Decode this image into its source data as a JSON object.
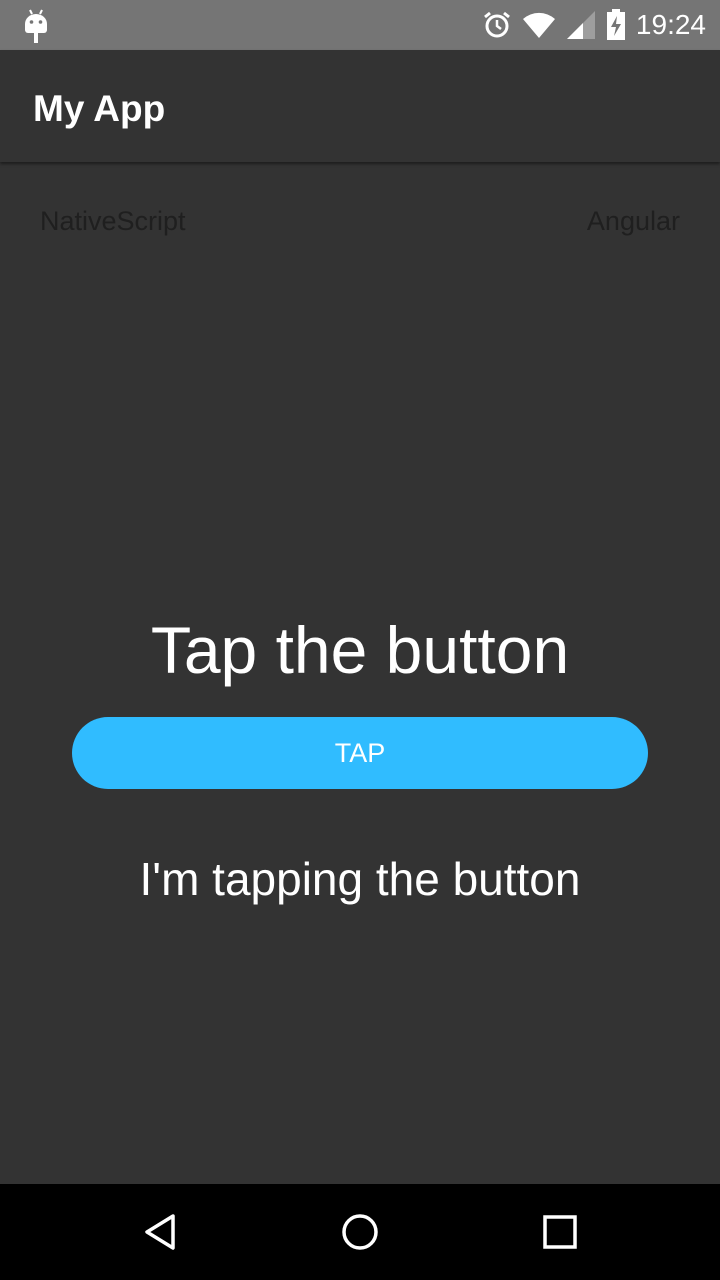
{
  "status_bar": {
    "time": "19:24",
    "icons": [
      "android-icon",
      "alarm-icon",
      "wifi-icon",
      "signal-icon",
      "battery-charging-icon"
    ]
  },
  "action_bar": {
    "title": "My App"
  },
  "content": {
    "label_left": "NativeScript",
    "label_right": "Angular",
    "headline": "Tap the button",
    "button_label": "TAP",
    "message": "I'm tapping the button"
  },
  "nav_bar": {
    "icons": [
      "back-icon",
      "home-icon",
      "recents-icon"
    ]
  },
  "colors": {
    "status_bar": "#757575",
    "background": "#333333",
    "accent": "#30bcff",
    "nav_bar": "#000000"
  }
}
